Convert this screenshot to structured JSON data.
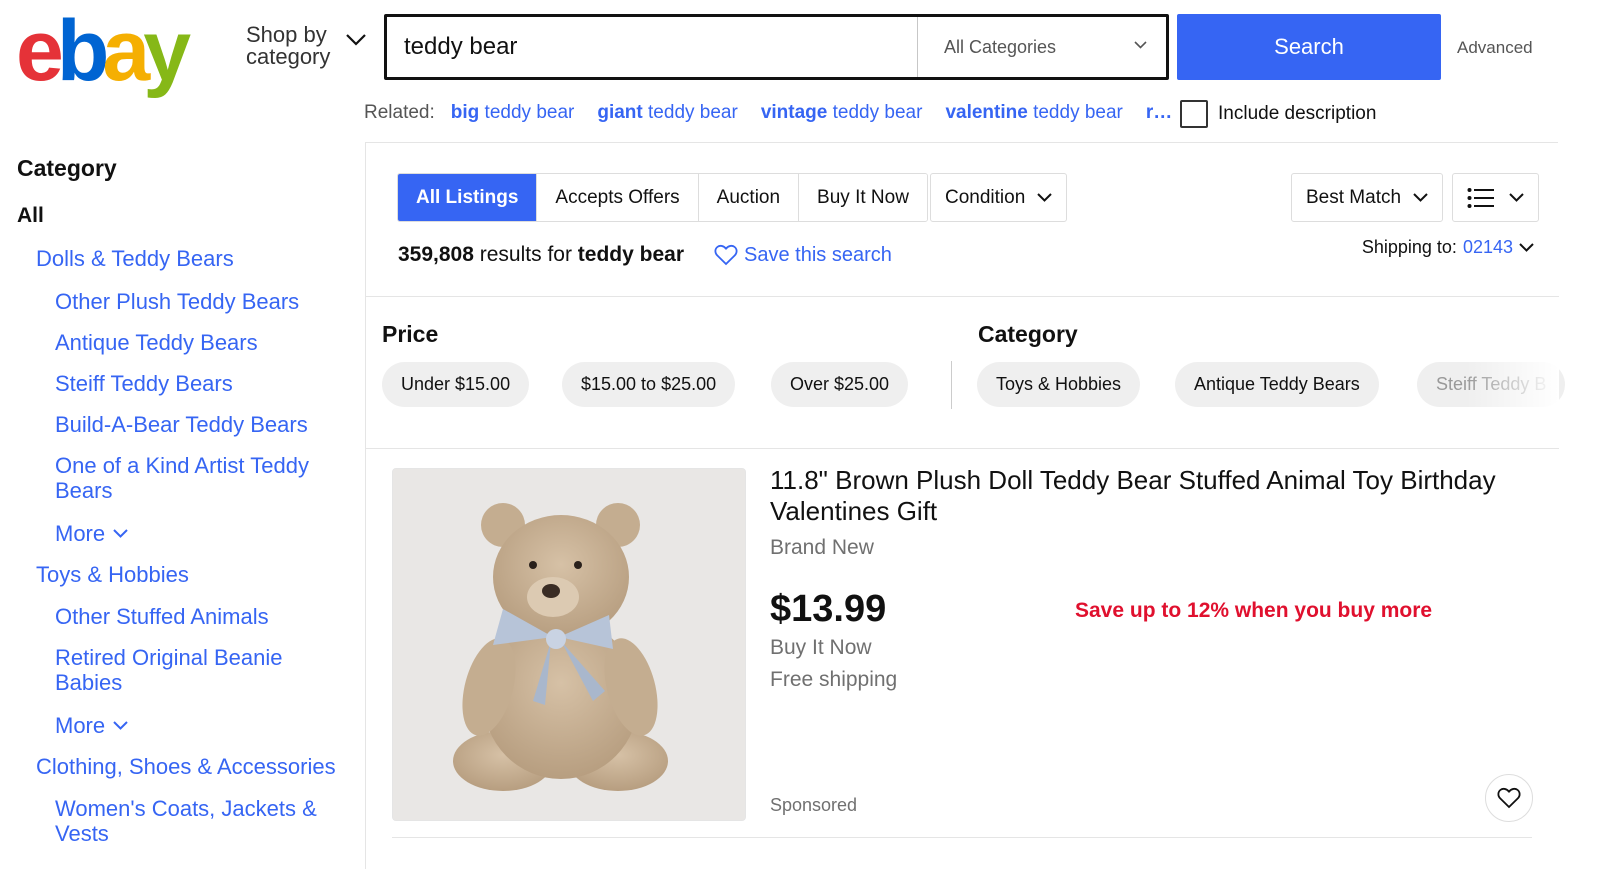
{
  "header": {
    "logo_text": "ebay",
    "shop_by_line1": "Shop by",
    "shop_by_line2": "category",
    "search_value": "teddy bear",
    "category_select": "All Categories",
    "search_button": "Search",
    "advanced_link": "Advanced"
  },
  "related": {
    "label": "Related:",
    "links": [
      {
        "bold": "big",
        "rest": " teddy bear"
      },
      {
        "bold": "giant",
        "rest": " teddy bear"
      },
      {
        "bold": "vintage",
        "rest": " teddy bear"
      },
      {
        "bold": "valentine",
        "rest": " teddy bear"
      },
      {
        "bold": "r…",
        "rest": ""
      }
    ],
    "include_description": "Include description"
  },
  "sidebar": {
    "heading": "Category",
    "all": "All",
    "items": [
      {
        "label": "Dolls & Teddy Bears",
        "level": 1
      },
      {
        "label": "Other Plush Teddy Bears",
        "level": 2
      },
      {
        "label": "Antique Teddy Bears",
        "level": 2
      },
      {
        "label": "Steiff Teddy Bears",
        "level": 2
      },
      {
        "label": "Build-A-Bear Teddy Bears",
        "level": 2
      },
      {
        "label": "One of a Kind Artist Teddy Bears",
        "level": 2
      },
      {
        "label": "More",
        "level": 2
      },
      {
        "label": "Toys & Hobbies",
        "level": 1
      },
      {
        "label": "Other Stuffed Animals",
        "level": 2
      },
      {
        "label": "Retired Original Beanie Babies",
        "level": 2
      },
      {
        "label": "More",
        "level": 2
      },
      {
        "label": "Clothing, Shoes & Accessories",
        "level": 1
      },
      {
        "label": "Women's Coats, Jackets & Vests",
        "level": 2
      }
    ]
  },
  "toolbar": {
    "tabs": [
      "All Listings",
      "Accepts Offers",
      "Auction",
      "Buy It Now"
    ],
    "active_tab": "All Listings",
    "condition": "Condition",
    "sort": "Best Match",
    "view_icon": "list-view-icon"
  },
  "results": {
    "count": "359,808",
    "results_for": " results for ",
    "query": "teddy bear",
    "save_search": "Save this search",
    "shipping_label": "Shipping to:",
    "shipping_zip": "02143"
  },
  "filters": {
    "price_heading": "Price",
    "price_pills": [
      "Under $15.00",
      "$15.00 to $25.00",
      "Over $25.00"
    ],
    "category_heading": "Category",
    "category_pills": [
      "Toys & Hobbies",
      "Antique Teddy Bears",
      "Steiff Teddy B"
    ]
  },
  "listing": {
    "title": "11.8\" Brown Plush Doll Teddy Bear Stuffed Animal Toy Birthday Valentines Gift",
    "condition": "Brand New",
    "price": "$13.99",
    "format": "Buy It Now",
    "shipping": "Free shipping",
    "promo": "Save up to 12% when you buy more",
    "sponsored": "Sponsored"
  },
  "colors": {
    "accent": "#3665f3",
    "promo_red": "#e0102e",
    "logo_e": "#e53238",
    "logo_b": "#0064d2",
    "logo_a": "#f5af02",
    "logo_y": "#86b817"
  }
}
